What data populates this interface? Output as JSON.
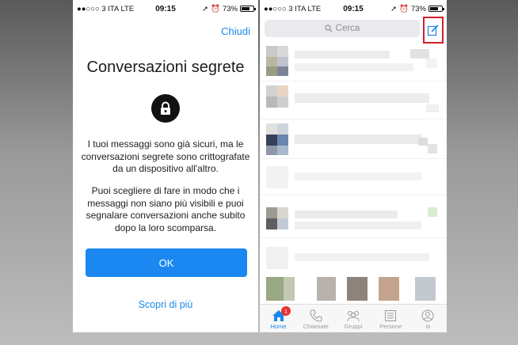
{
  "left_screen": {
    "status": {
      "carrier": "●●○○○ 3 ITA   LTE",
      "time": "09:15",
      "battery": "73%",
      "battery_level": 0.73
    },
    "close_label": "Chiudi",
    "title": "Conversazioni segrete",
    "paragraph1": "I tuoi messaggi sono già sicuri, ma le conversazioni segrete sono crittografate da un dispositivo all'altro.",
    "paragraph2": "Puoi scegliere di fare in modo che i messaggi non siano più visibili e puoi segnalare conversazioni anche subito dopo la loro scomparsa.",
    "ok_label": "OK",
    "learn_more_label": "Scopri di più",
    "accent_color": "#1a88f0"
  },
  "right_screen": {
    "status": {
      "carrier": "●●○○○ 3 ITA   LTE",
      "time": "09:15",
      "battery": "73%",
      "battery_level": 0.73
    },
    "search_placeholder": "Cerca",
    "highlight_color": "#d01f2a",
    "tabs": [
      {
        "label": "Home",
        "icon": "home-icon",
        "active": true,
        "badge": "1"
      },
      {
        "label": "Chiamate",
        "icon": "phone-icon",
        "active": false
      },
      {
        "label": "Gruppi",
        "icon": "group-icon",
        "active": false
      },
      {
        "label": "Persone",
        "icon": "list-icon",
        "active": false
      },
      {
        "label": "Io",
        "icon": "profile-icon",
        "active": false
      }
    ]
  }
}
